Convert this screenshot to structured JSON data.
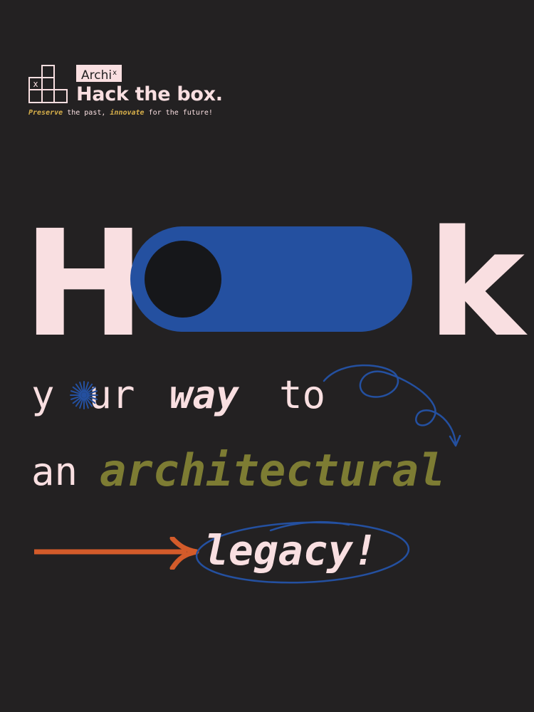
{
  "logo": {
    "badge": "Archi",
    "badge_sup": "x",
    "mark_letter": "x",
    "title": "Hack the box.",
    "tagline": {
      "word1": "Preserve",
      "part2": " the past, ",
      "word3": "innovate",
      "part4": " for the future!"
    }
  },
  "headline": {
    "first_letter": "H",
    "last_letter": "k",
    "toggle_state": "on"
  },
  "line1": {
    "your_a": "y",
    "your_b": "ur",
    "way": "way",
    "to": "to"
  },
  "line2": {
    "an": "an",
    "architectural": "architectural"
  },
  "line3": {
    "legacy": "legacy!"
  },
  "colors": {
    "background": "#232122",
    "pink": "#f9dfe1",
    "blue": "#2450a0",
    "olive": "#7d7c33",
    "orange": "#d35b2a",
    "gold": "#d8b04a"
  },
  "icons": [
    "box-grid-logo-icon",
    "starburst-icon",
    "curly-arrow-icon",
    "long-arrow-icon",
    "ellipse-circle-icon"
  ]
}
